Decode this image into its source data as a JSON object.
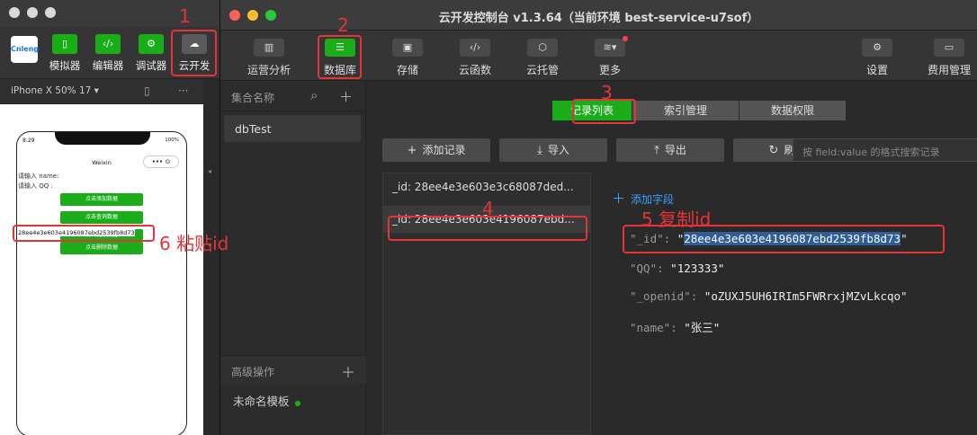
{
  "devtools": {
    "logo_text": "Cnleng",
    "toolbar": [
      {
        "label": "模拟器",
        "icon": "phone-icon",
        "glyph": "▯"
      },
      {
        "label": "编辑器",
        "icon": "code-icon",
        "glyph": "‹/›"
      },
      {
        "label": "调试器",
        "icon": "debug-icon",
        "glyph": "⚙"
      },
      {
        "label": "云开发",
        "icon": "cloud-icon",
        "glyph": "☁"
      }
    ],
    "device_label": "iPhone X 50% 17 ▾",
    "phone": {
      "time": "8:29",
      "battery": "100%",
      "nav_title": "Weixin",
      "capsule": "••• ⊙",
      "name_label": "请输入 name:",
      "qq_label": "请输入 QQ :",
      "buttons": [
        "点击添加数据",
        "点击查询数据",
        "点击更新数据",
        "点击删除数据"
      ],
      "pasted_id": "28ee4e3e603e4196087ebd2539fb8d73"
    }
  },
  "console": {
    "title": "云开发控制台 v1.3.64（当前环境 best-service-u7sof）",
    "toolbar": [
      {
        "label": "运营分析",
        "icon": "chart-icon",
        "glyph": "▥"
      },
      {
        "label": "数据库",
        "icon": "database-icon",
        "glyph": "☰"
      },
      {
        "label": "存储",
        "icon": "storage-icon",
        "glyph": "▣"
      },
      {
        "label": "云函数",
        "icon": "function-icon",
        "glyph": "‹/›"
      },
      {
        "label": "云托管",
        "icon": "cube-icon",
        "glyph": "⬡"
      },
      {
        "label": "更多",
        "icon": "layers-icon",
        "glyph": "≋▾"
      },
      {
        "label": "设置",
        "icon": "gear-icon",
        "glyph": "⚙"
      },
      {
        "label": "费用管理",
        "icon": "billing-icon",
        "glyph": "▭"
      }
    ],
    "collections_header": "集合名称",
    "collection": "dbTest",
    "advanced_header": "高级操作",
    "template_item": "未命名模板",
    "tabs": [
      "记录列表",
      "索引管理",
      "数据权限"
    ],
    "actions": [
      {
        "label": "添加记录",
        "glyph": "+"
      },
      {
        "label": "导入",
        "glyph": "⤓"
      },
      {
        "label": "导出",
        "glyph": "⤒"
      },
      {
        "label": "刷新",
        "glyph": "↻"
      }
    ],
    "search_placeholder": "按 field:value 的格式搜索记录",
    "records": [
      "_id: 28ee4e3e603e3c68087ded...",
      "_id: 28ee4e3e603e4196087ebd..."
    ],
    "add_field": "添加字段",
    "fields": [
      {
        "key": "\"_id\"",
        "value": "28ee4e3e603e4196087ebd2539fb8d73"
      },
      {
        "key": "\"QQ\"",
        "value": "\"123333\""
      },
      {
        "key": "\"_openid\"",
        "value": "\"oZUXJ5UH6IRIm5FWRrxjMZvLkcqo\""
      },
      {
        "key": "\"name\"",
        "value": "\"张三\""
      }
    ]
  },
  "annotations": {
    "step1": "1",
    "step2": "2",
    "step3": "3",
    "step4": "4",
    "step5": "5 复制id",
    "step6": "6 粘贴id",
    "color": "#e5333a"
  }
}
